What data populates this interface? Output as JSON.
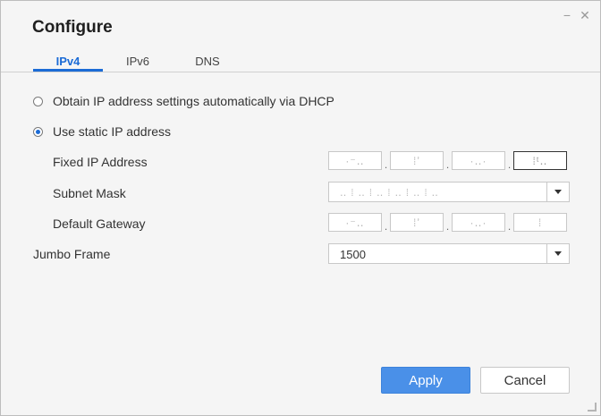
{
  "window": {
    "title": "Configure"
  },
  "tabs": [
    {
      "label": "IPv4",
      "active": true
    },
    {
      "label": "IPv6",
      "active": false
    },
    {
      "label": "DNS",
      "active": false
    }
  ],
  "ipv4": {
    "dhcp_label": "Obtain IP address settings automatically via DHCP",
    "static_label": "Use static IP address",
    "selected_mode": "static",
    "fixed_ip": {
      "label": "Fixed IP Address",
      "octets": [
        "·⁻‥",
        "⁞ʼ",
        "·‥·",
        "⁞ᵗ‥"
      ]
    },
    "subnet_mask": {
      "label": "Subnet Mask",
      "value": "‥ ⁞ ‥ ⁞ ‥ ⁞ ‥ ⁞ ‥ ⁞ ‥"
    },
    "default_gateway": {
      "label": "Default Gateway",
      "octets": [
        "·⁻‥",
        "⁞ʼ",
        "·‥·",
        "⁞"
      ]
    },
    "jumbo_frame": {
      "label": "Jumbo Frame",
      "value": "1500"
    }
  },
  "buttons": {
    "apply": "Apply",
    "cancel": "Cancel"
  },
  "icons": {
    "minimize": "minimize-icon",
    "close": "close-icon",
    "dropdown": "chevron-down-icon"
  },
  "colors": {
    "accent": "#1b6bd6",
    "apply_button": "#4a90e8"
  }
}
